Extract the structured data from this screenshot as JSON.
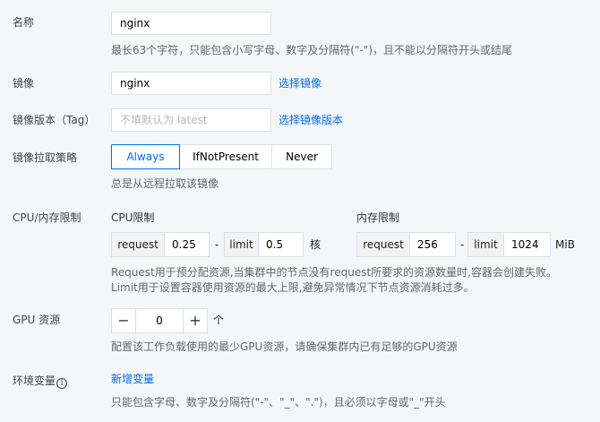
{
  "name": {
    "label": "名称",
    "value": "nginx",
    "hint": "最长63个字符，只能包含小写字母、数字及分隔符(\"-\")，且不能以分隔符开头或结尾"
  },
  "image": {
    "label": "镜像",
    "value": "nginx",
    "select_link": "选择镜像"
  },
  "image_tag": {
    "label": "镜像版本（Tag）",
    "placeholder": "不填默认为 latest",
    "select_link": "选择镜像版本"
  },
  "pull_policy": {
    "label": "镜像拉取策略",
    "options": [
      "Always",
      "IfNotPresent",
      "Never"
    ],
    "selected": "Always",
    "hint": "总是从远程拉取该镜像"
  },
  "resources": {
    "label": "CPU/内存限制",
    "cpu": {
      "title": "CPU限制",
      "request_label": "request",
      "request_value": "0.25",
      "limit_label": "limit",
      "limit_value": "0.5",
      "unit": "核"
    },
    "memory": {
      "title": "内存限制",
      "request_label": "request",
      "request_value": "256",
      "limit_label": "limit",
      "limit_value": "1024",
      "unit": "MiB"
    },
    "separator": "-",
    "hint_line1": "Request用于预分配资源,当集群中的节点没有request所要求的资源数量时,容器会创建失败。",
    "hint_line2": "Limit用于设置容器使用资源的最大上限,避免异常情况下节点资源消耗过多。"
  },
  "gpu": {
    "label": "GPU 资源",
    "minus": "−",
    "value": "0",
    "plus": "+",
    "unit": "个",
    "hint": "配置该工作负载使用的最少GPU资源，请确保集群内已有足够的GPU资源"
  },
  "env": {
    "label": "环境变量",
    "info_glyph": "i",
    "add_link": "新增变量",
    "hint": "只能包含字母、数字及分隔符(\"-\"、\"_\"、\".\")，且必须以字母或\"_\"开头"
  },
  "colors": {
    "accent": "#006eff",
    "background": "#f5f6f7"
  }
}
